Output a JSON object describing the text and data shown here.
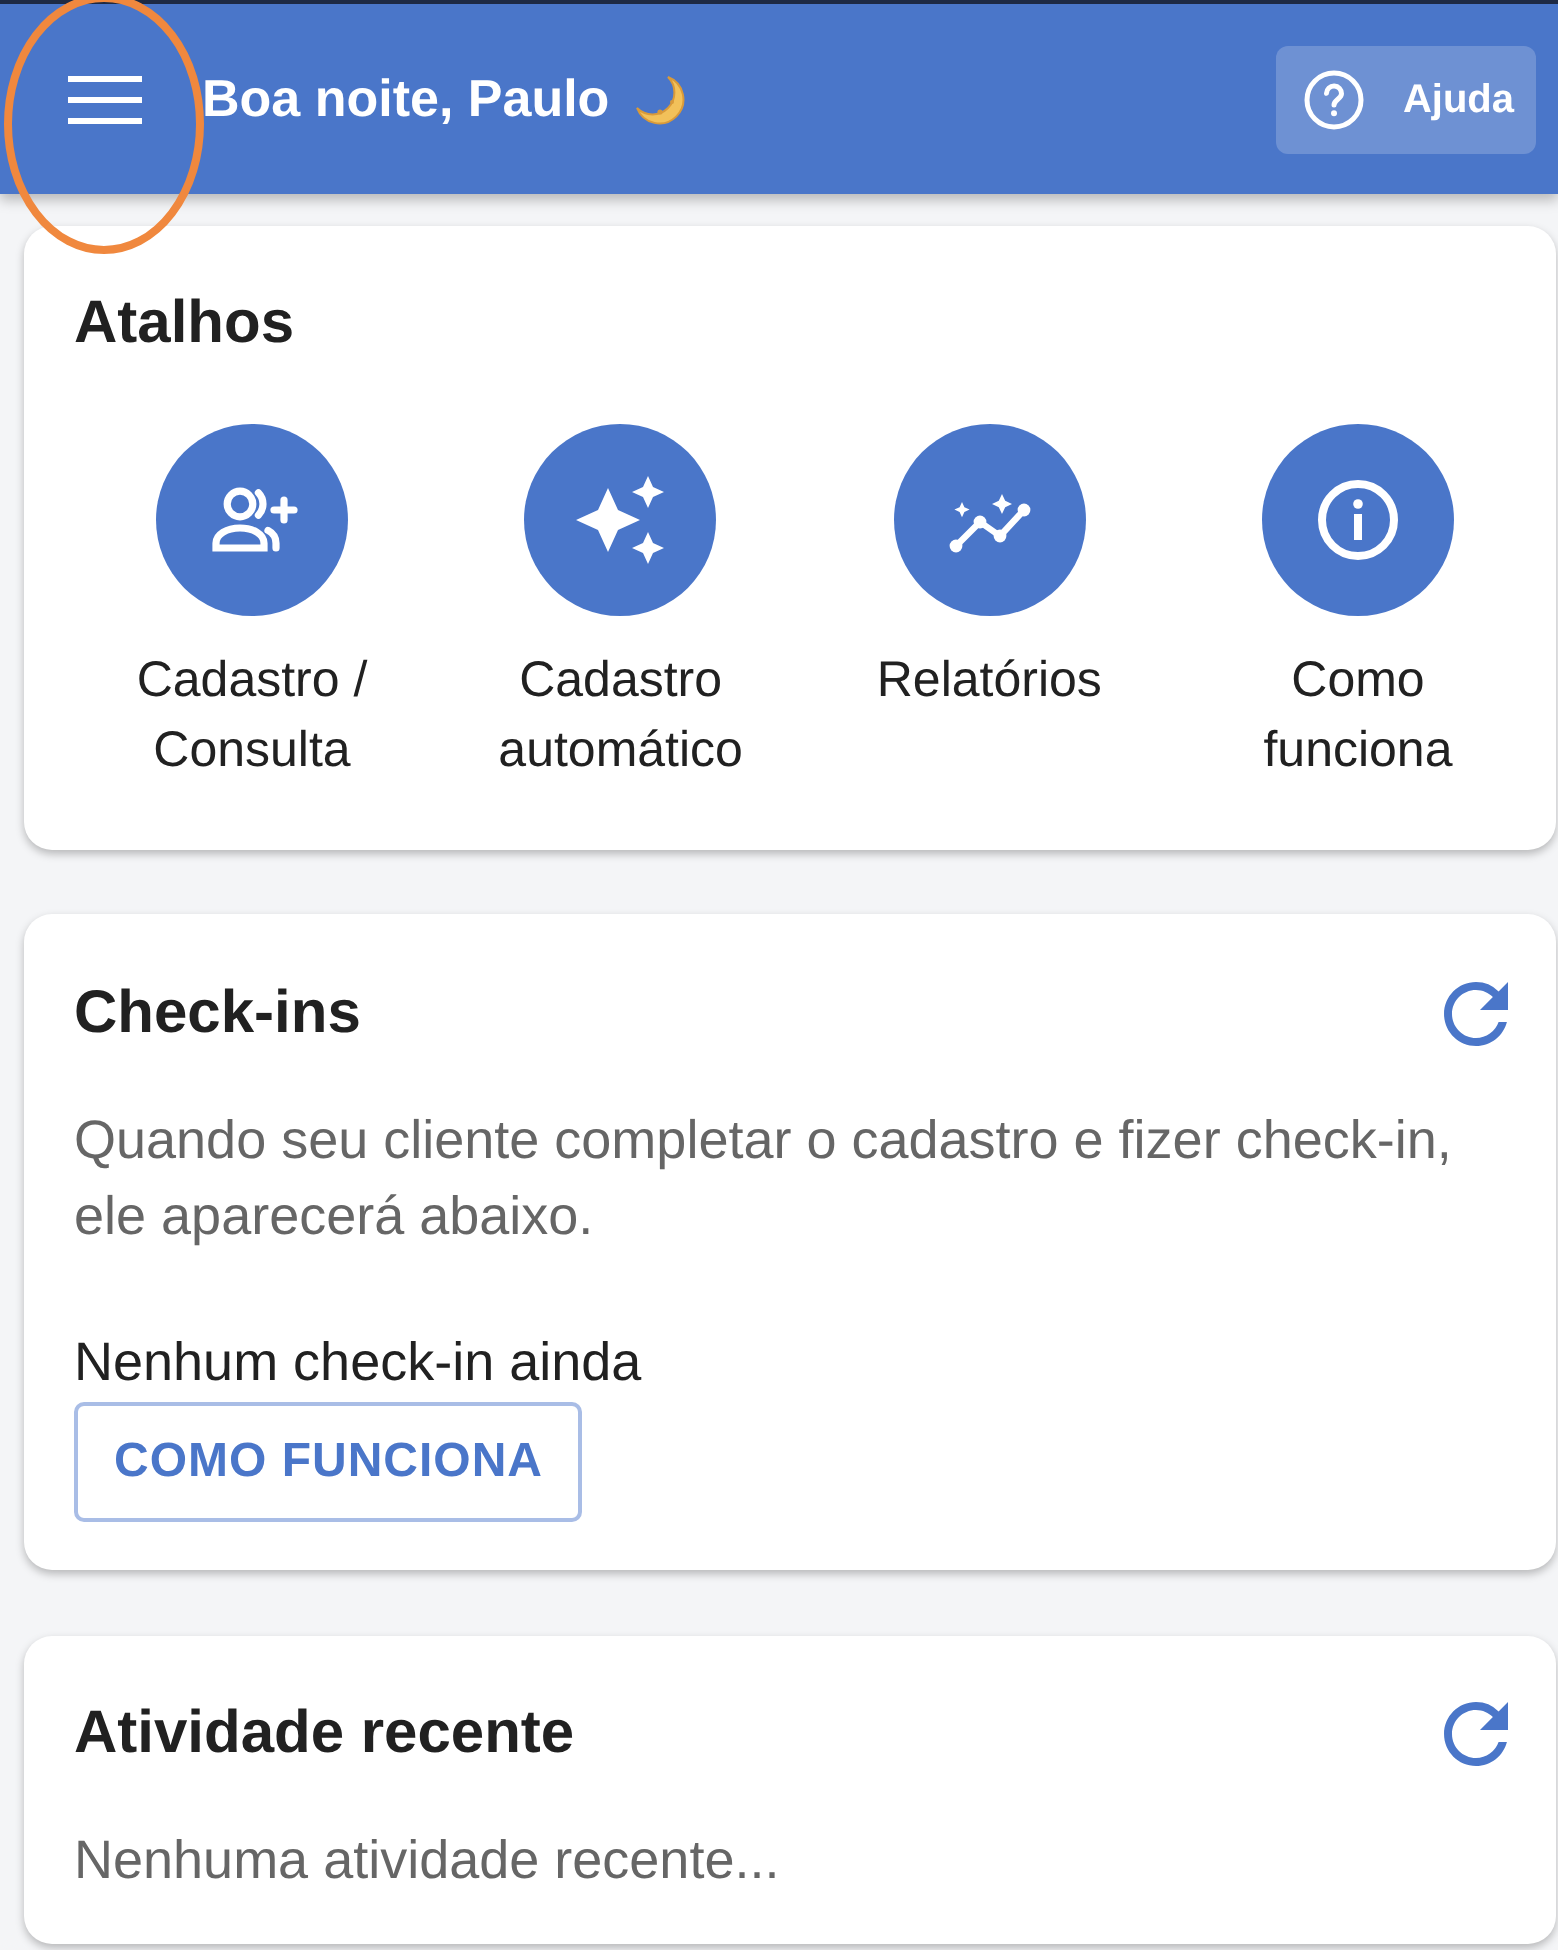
{
  "header": {
    "menu_button": {
      "highlighted": true
    },
    "greeting": "Boa noite, Paulo",
    "help_button": {
      "label": "Ajuda"
    }
  },
  "shortcuts": {
    "title": "Atalhos",
    "items": [
      {
        "label": "Cadastro / Consulta"
      },
      {
        "label": "Cadastro automático"
      },
      {
        "label": "Relatórios"
      },
      {
        "label": "Como funciona"
      }
    ]
  },
  "checkins": {
    "title": "Check-ins",
    "description": "Quando seu cliente completar o cadastro e fizer check-in, ele aparecerá abaixo.",
    "empty_message": "Nenhum check-in ainda",
    "button": "COMO FUNCIONA"
  },
  "recent_activity": {
    "title": "Atividade recente",
    "empty_message": "Nenhuma atividade recente..."
  }
}
